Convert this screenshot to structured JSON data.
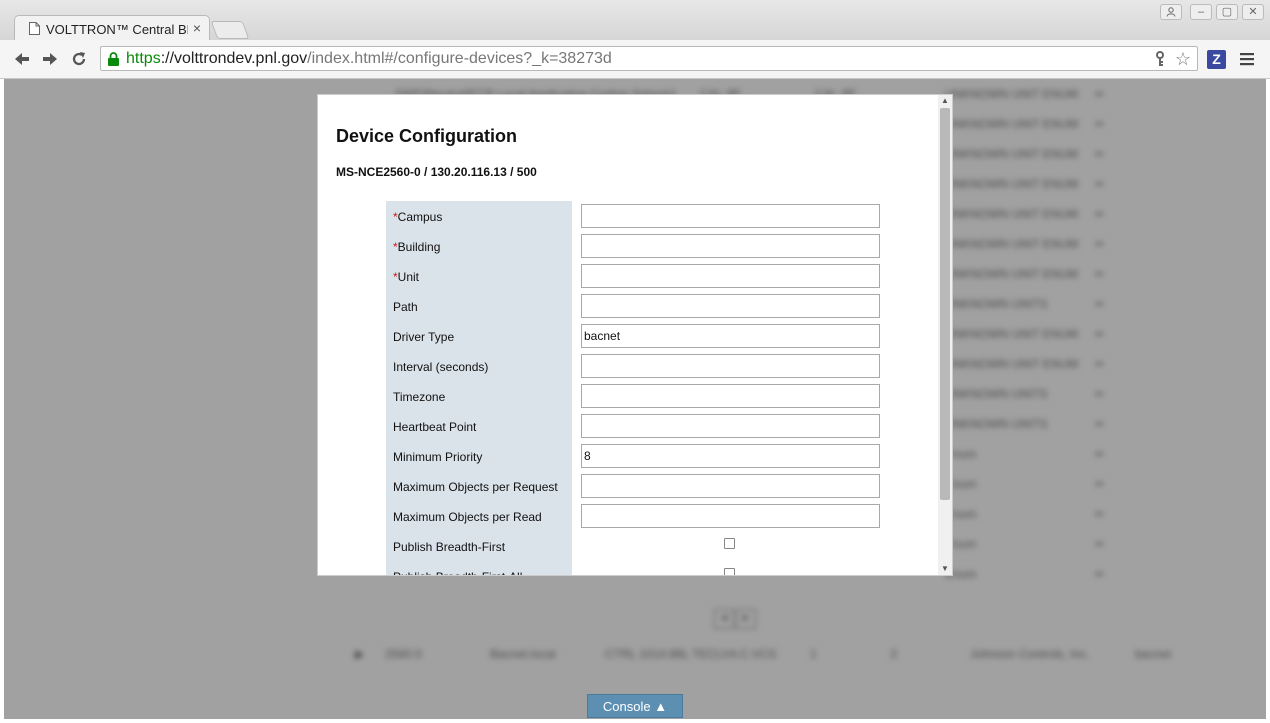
{
  "browser": {
    "tab_title": "VOLTTRON™ Central BE",
    "tab_close": "×",
    "url": {
      "scheme": "https",
      "sep": "://",
      "host": "volttrondev.pnl.gov",
      "rest": "/index.html#/configure-devices?_k=38273d"
    },
    "extension_letter": "Z",
    "back_glyph": "🡐",
    "forward_glyph": "🡒",
    "reload_glyph": "⟳",
    "star_glyph": "☆",
    "window_buttons": [
      "",
      "–",
      "▢",
      "✕"
    ]
  },
  "modal": {
    "title": "Device Configuration",
    "device_id": "MS-NCE2560-0 / 130.20.116.13 / 500",
    "fields": [
      {
        "label": "Campus",
        "required": true,
        "value": "",
        "type": "text"
      },
      {
        "label": "Building",
        "required": true,
        "value": "",
        "type": "text"
      },
      {
        "label": "Unit",
        "required": true,
        "value": "",
        "type": "text"
      },
      {
        "label": "Path",
        "required": false,
        "value": "",
        "type": "text"
      },
      {
        "label": "Driver Type",
        "required": false,
        "value": "bacnet",
        "type": "text"
      },
      {
        "label": "Interval (seconds)",
        "required": false,
        "value": "",
        "type": "text"
      },
      {
        "label": "Timezone",
        "required": false,
        "value": "",
        "type": "text"
      },
      {
        "label": "Heartbeat Point",
        "required": false,
        "value": "",
        "type": "text"
      },
      {
        "label": "Minimum Priority",
        "required": false,
        "value": "8",
        "type": "text"
      },
      {
        "label": "Maximum Objects per Request",
        "required": false,
        "value": "",
        "type": "text"
      },
      {
        "label": "Maximum Objects per Read",
        "required": false,
        "value": "",
        "type": "text"
      },
      {
        "label": "Publish Breadth-First",
        "required": false,
        "value": false,
        "type": "checkbox"
      },
      {
        "label": "Publish Breadth-First-All",
        "required": false,
        "value": false,
        "type": "checkbox"
      }
    ],
    "required_marker": "*"
  },
  "console": {
    "label": "Console ▲"
  },
  "background_rows": [
    [
      "SWD/Neutral/ECR Local Application Coding Setpoint",
      "CAL.8E",
      "CAL.8E",
      "UNKNOWN UNIT ENUM",
      "••"
    ],
    [
      "",
      "",
      "",
      "UNKNOWN UNIT ENUM",
      "••"
    ],
    [
      "",
      "",
      "",
      "UNKNOWN UNIT ENUM",
      "••"
    ],
    [
      "",
      "",
      "",
      "UNKNOWN UNIT ENUM",
      "••"
    ],
    [
      "",
      "",
      "",
      "UNKNOWN UNIT ENUM",
      "••"
    ],
    [
      "",
      "",
      "",
      "UNKNOWN UNIT ENUM",
      "••"
    ],
    [
      "",
      "",
      "",
      "UNKNOWN UNIT ENUM",
      "••"
    ],
    [
      "",
      "",
      "",
      "UNKNOWN UNITS",
      "••"
    ],
    [
      "",
      "",
      "",
      "UNKNOWN UNIT ENUM",
      "••"
    ],
    [
      "",
      "",
      "",
      "UNKNOWN UNIT ENUM",
      "••"
    ],
    [
      "",
      "",
      "",
      "UNKNOWN UNITS",
      "••"
    ],
    [
      "",
      "",
      "",
      "UNKNOWN UNITS",
      "••"
    ],
    [
      "",
      "",
      "",
      "Enum",
      "••"
    ],
    [
      "",
      "",
      "",
      "Enum",
      "••"
    ],
    [
      "",
      "",
      "",
      "Enum",
      "••"
    ],
    [
      "",
      "",
      "",
      "Enum",
      "••"
    ],
    [
      "",
      "",
      "",
      "Enum",
      "••"
    ]
  ],
  "pager": [
    "◂",
    "▸"
  ],
  "device_row": [
    "▶",
    "2560.0",
    "Bacnet.local",
    "CTRL 1014.88L TECLV4.C.VCS",
    "1",
    "3",
    "Johnson Controls, Inc.",
    "bacnet"
  ]
}
